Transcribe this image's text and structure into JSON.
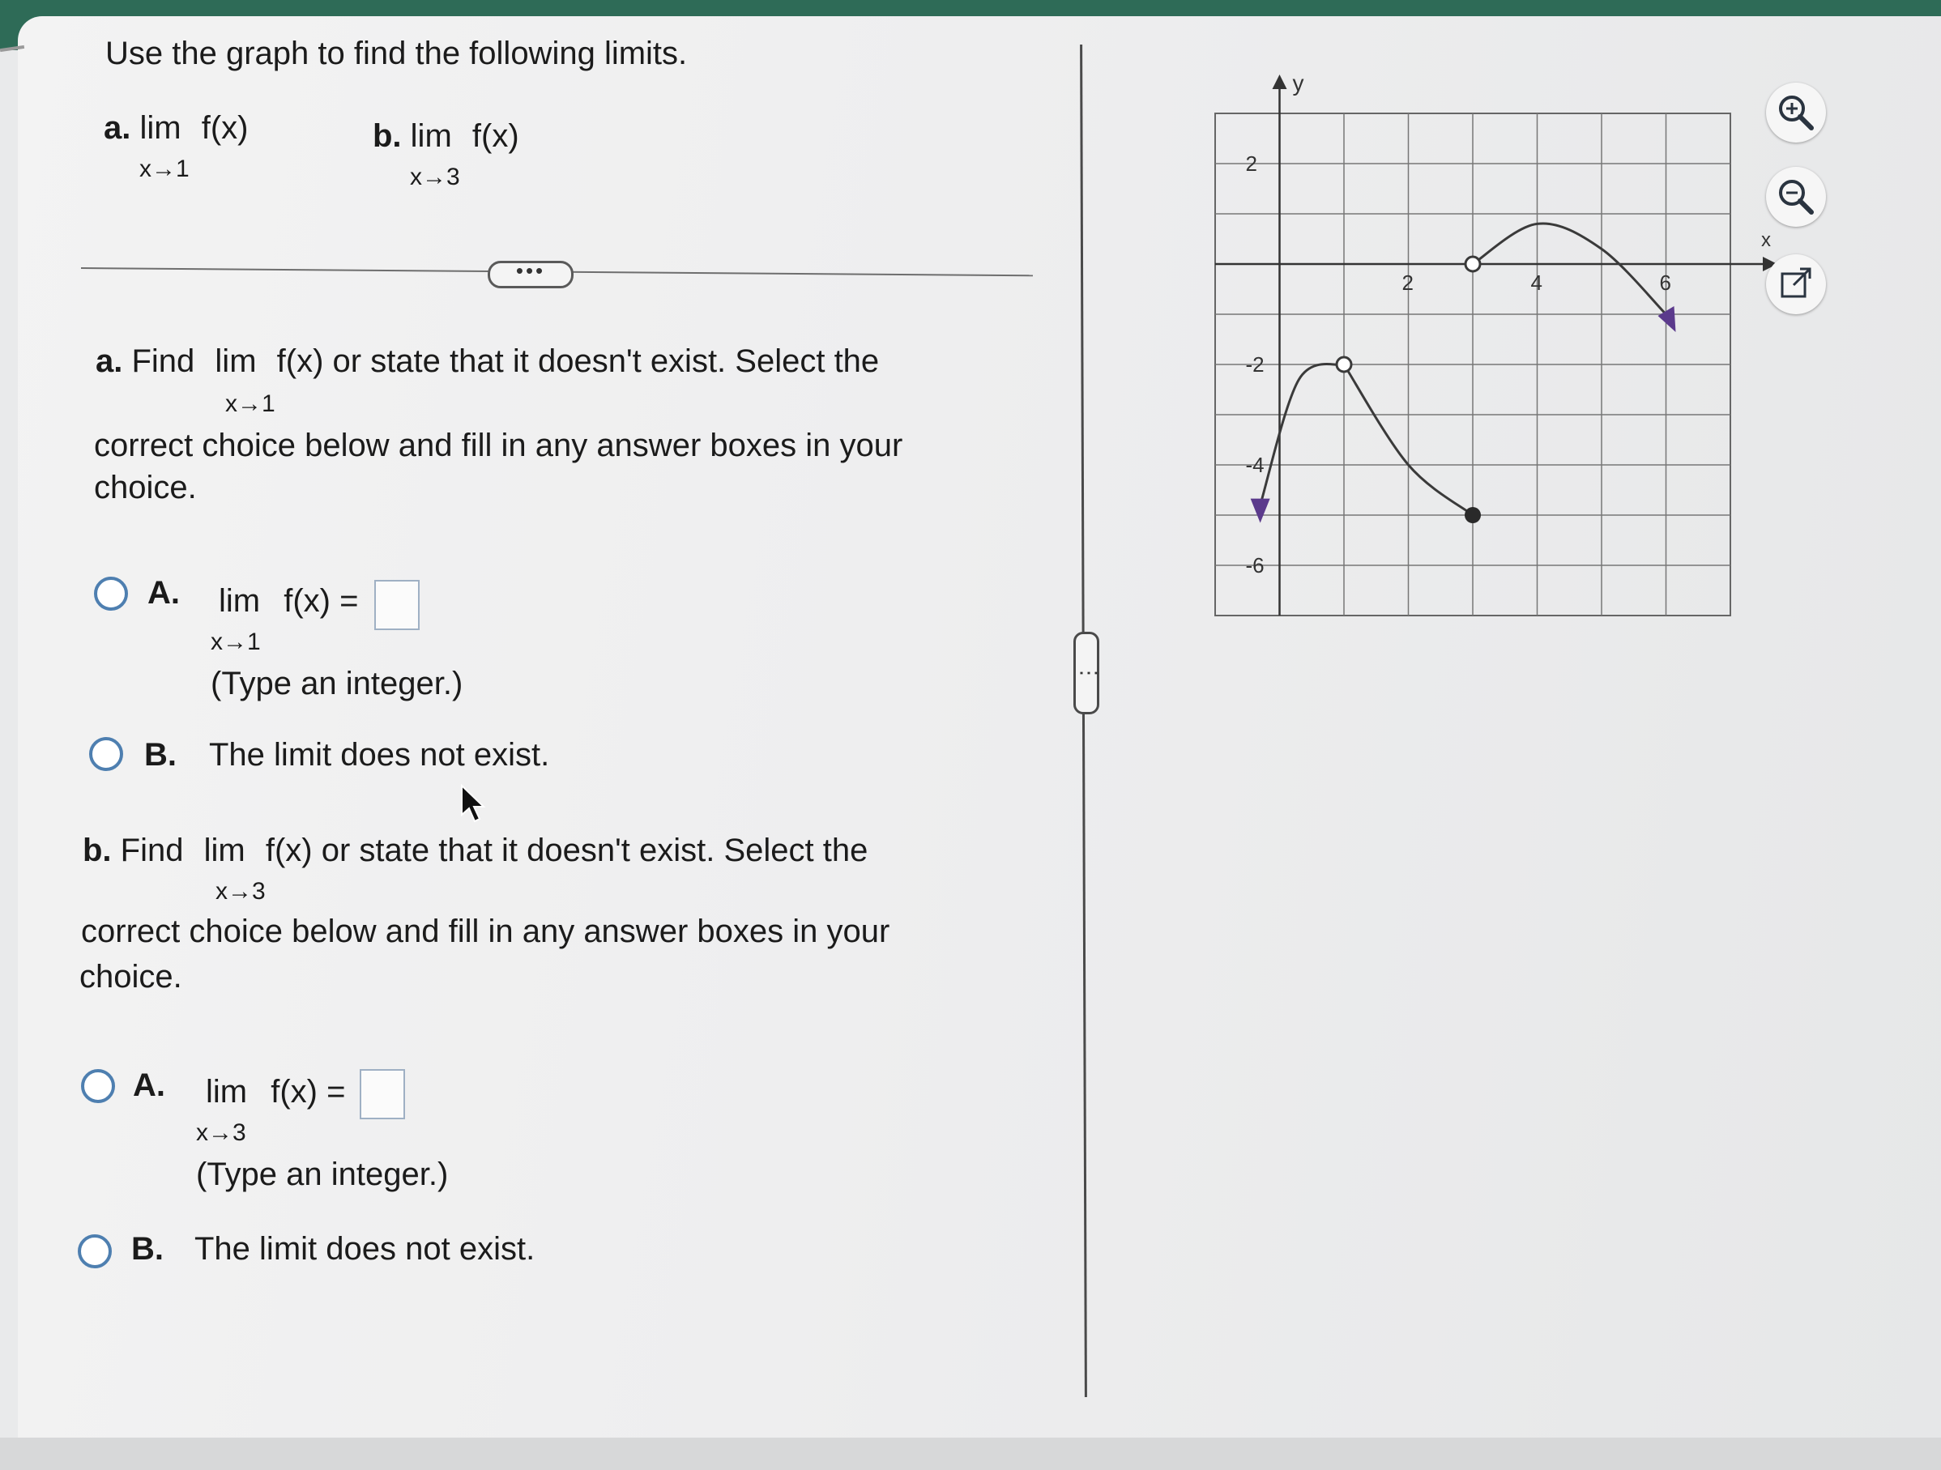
{
  "instructions": "Use the graph to find the following limits.",
  "summary_parts": [
    {
      "letter": "a.",
      "lim": "lim",
      "func": "f(x)",
      "sub": "x→1"
    },
    {
      "letter": "b.",
      "lim": "lim",
      "func": "f(x)",
      "sub": "x→3"
    }
  ],
  "ellipsis": "•••",
  "part_a": {
    "letter": "a.",
    "find": "Find",
    "lim": "lim",
    "sub": "x→1",
    "rest": "f(x) or state that it doesn't exist. Select the",
    "line2": "correct choice below and fill in any answer boxes in your",
    "line3": "choice.",
    "choice_a": {
      "label": "A.",
      "lim": "lim",
      "expr": "f(x) =",
      "sub": "x→1",
      "hint": "(Type an integer.)",
      "value": ""
    },
    "choice_b": {
      "label": "B.",
      "text": "The limit does not exist."
    }
  },
  "part_b": {
    "letter": "b.",
    "find": "Find",
    "lim": "lim",
    "sub": "x→3",
    "rest": "f(x) or state that it doesn't exist. Select the",
    "line2": "correct choice below and fill in any answer boxes in your",
    "line3": "choice.",
    "choice_a": {
      "label": "A.",
      "lim": "lim",
      "expr": "f(x) =",
      "sub": "x→3",
      "hint": "(Type an integer.)",
      "value": ""
    },
    "choice_b": {
      "label": "B.",
      "text": "The limit does not exist."
    }
  },
  "graph": {
    "x_axis_label": "x",
    "y_axis_label": "y",
    "x_ticks": [
      "2",
      "4",
      "6"
    ],
    "y_ticks": [
      "2",
      "-2",
      "-4",
      "-6"
    ],
    "x_range": [
      -1,
      7
    ],
    "y_range": [
      -7,
      3
    ],
    "curve_left_points": [
      [
        -0.3,
        -4.8
      ],
      [
        0.3,
        -2.3
      ],
      [
        1,
        -2
      ]
    ],
    "curve_right_points": [
      [
        1,
        -2
      ],
      [
        2,
        -4
      ],
      [
        3,
        -5
      ]
    ],
    "curve_top_points": [
      [
        3,
        0
      ],
      [
        4,
        0.8
      ],
      [
        5,
        0.3
      ],
      [
        6,
        -1
      ]
    ],
    "open_points": [
      [
        1,
        -2
      ],
      [
        3,
        0
      ]
    ],
    "closed_points": [
      [
        3,
        -5
      ]
    ],
    "arrow_ends": [
      [
        -0.3,
        -4.8
      ],
      [
        6,
        -1
      ]
    ],
    "curve_color": "#3a3a3a",
    "arrow_color": "#5b3a8c"
  },
  "tools": [
    "zoom-in-icon",
    "zoom-out-icon",
    "external-link-icon"
  ]
}
